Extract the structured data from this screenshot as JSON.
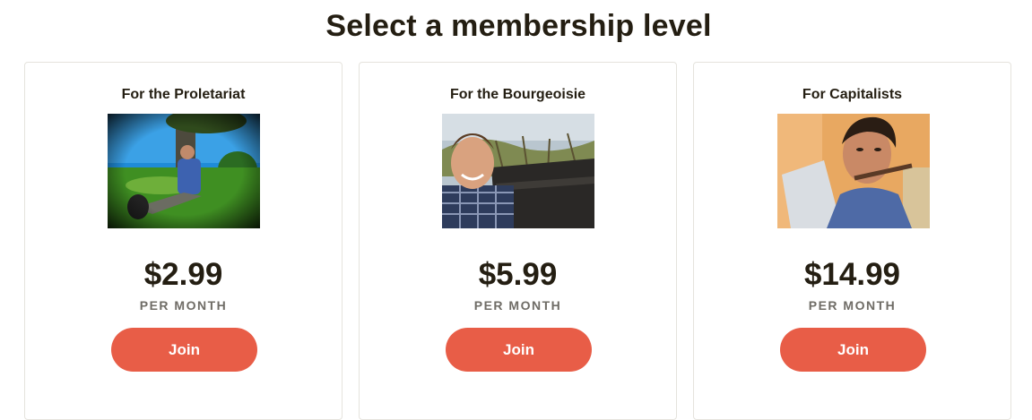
{
  "page": {
    "title": "Select a membership level"
  },
  "tiers": [
    {
      "name": "For the Proletariat",
      "price": "$2.99",
      "period": "PER MONTH",
      "button": "Join"
    },
    {
      "name": "For the Bourgeoisie",
      "price": "$5.99",
      "period": "PER MONTH",
      "button": "Join"
    },
    {
      "name": "For Capitalists",
      "price": "$14.99",
      "period": "PER MONTH",
      "button": "Join"
    }
  ],
  "colors": {
    "accent": "#e85d47",
    "text": "#241e12",
    "muted": "#6f6c66",
    "border": "#e5e3dd"
  }
}
